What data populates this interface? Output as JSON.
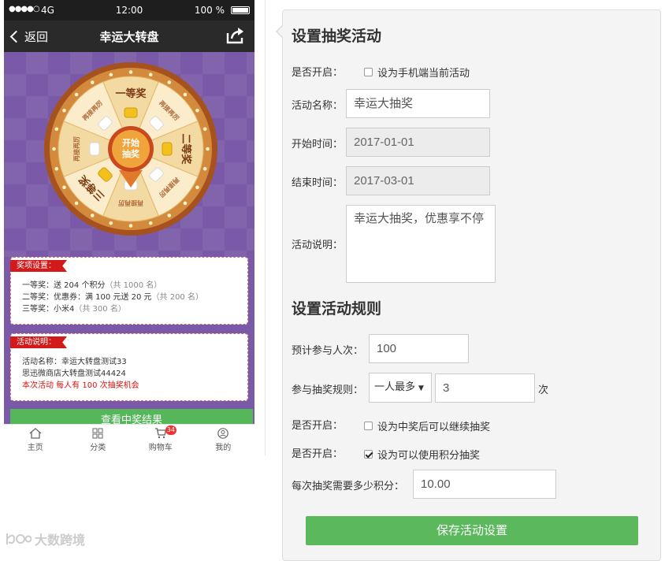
{
  "phone": {
    "status": {
      "signal": "●●●●○",
      "carrier": "4G",
      "time": "12:00",
      "battery": "100 %"
    },
    "nav": {
      "back_label": "返回",
      "title": "幸运大转盘"
    },
    "wheel": {
      "center_label": "开始抽奖",
      "segments": [
        "一等奖",
        "再接再厉",
        "二等奖",
        "再接再厉",
        "再接再厉",
        "三等奖",
        "再接再厉",
        "再接再厉"
      ]
    },
    "prize_card": {
      "tag": "奖项设置：",
      "lines": [
        {
          "name": "一等奖：",
          "text": "送 204 个积分",
          "count": "（共 1000 名）"
        },
        {
          "name": "二等奖：",
          "text": "优惠券：满 100 元送 20 元",
          "count": "（共 200 名）"
        },
        {
          "name": "三等奖：",
          "text": "小米4",
          "count": "（共 300 名）"
        }
      ]
    },
    "desc_card": {
      "tag": "活动说明：",
      "line1": "活动名称：幸运大转盘测试33",
      "line2": "思迅微商店大转盘测试44424",
      "line3": "本次活动 每人有 100 次抽奖机会"
    },
    "result_button": "查看中奖结果",
    "tabbar": [
      {
        "label": "主页",
        "icon": "home-icon"
      },
      {
        "label": "分类",
        "icon": "category-icon"
      },
      {
        "label": "购物车",
        "icon": "cart-icon",
        "badge": "34"
      },
      {
        "label": "我的",
        "icon": "user-icon"
      }
    ]
  },
  "watermark": "大数跨境",
  "settings": {
    "section1_title": "设置抽奖活动",
    "enable_label": "是否开启：",
    "enable_check_label": "设为手机端当前活动",
    "enable_checked": false,
    "name_label": "活动名称：",
    "name_value": "幸运大抽奖",
    "start_label": "开始时间：",
    "start_value": "2017-01-01",
    "end_label": "结束时间：",
    "end_value": "2017-03-01",
    "desc_label": "活动说明：",
    "desc_value": "幸运大抽奖，优惠享不停",
    "section2_title": "设置活动规则",
    "expected_label": "预计参与人次：",
    "expected_value": "100",
    "rule_label": "参与抽奖规则：",
    "rule_select": "一人最多",
    "rule_value": "3",
    "rule_unit": "次",
    "continue_label": "是否开启：",
    "continue_check_label": "设为中奖后可以继续抽奖",
    "continue_checked": false,
    "points_label": "是否开启：",
    "points_check_label": "设为可以使用积分抽奖",
    "points_checked": true,
    "cost_label": "每次抽奖需要多少积分：",
    "cost_value": "10.00",
    "save_button": "保存活动设置"
  },
  "colors": {
    "accent_green": "#5cb85c",
    "tag_red": "#d21a1a",
    "stage_purple": "#7a5aa8",
    "wheel_orange": "#e07a2a"
  }
}
